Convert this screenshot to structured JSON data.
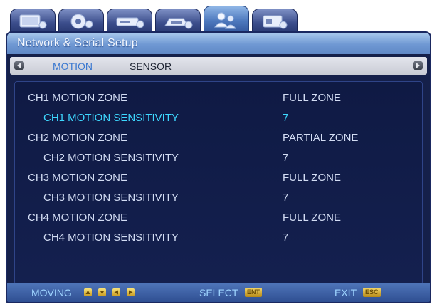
{
  "tabs": [
    {
      "name": "display",
      "icon": "display-setup-icon",
      "active": false
    },
    {
      "name": "record",
      "icon": "record-setup-icon",
      "active": false
    },
    {
      "name": "storage",
      "icon": "storage-setup-icon",
      "active": false
    },
    {
      "name": "schedule",
      "icon": "schedule-setup-icon",
      "active": false
    },
    {
      "name": "network",
      "icon": "network-setup-icon",
      "active": true
    },
    {
      "name": "system",
      "icon": "system-setup-icon",
      "active": false
    }
  ],
  "title": "Network & Serial Setup",
  "sub_tabs": {
    "motion": "MOTION",
    "sensor": "SENSOR",
    "active": "motion"
  },
  "settings": [
    {
      "label": "CH1 MOTION ZONE",
      "value": "FULL ZONE",
      "kind": "zone",
      "selected": false
    },
    {
      "label": "CH1 MOTION SENSITIVITY",
      "value": "7",
      "kind": "sens",
      "selected": true
    },
    {
      "label": "CH2 MOTION ZONE",
      "value": "PARTIAL ZONE",
      "kind": "zone",
      "selected": false
    },
    {
      "label": "CH2 MOTION SENSITIVITY",
      "value": "7",
      "kind": "sens",
      "selected": false
    },
    {
      "label": "CH3 MOTION ZONE",
      "value": "FULL ZONE",
      "kind": "zone",
      "selected": false
    },
    {
      "label": "CH3 MOTION SENSITIVITY",
      "value": "7",
      "kind": "sens",
      "selected": false
    },
    {
      "label": "CH4 MOTION ZONE",
      "value": "FULL ZONE",
      "kind": "zone",
      "selected": false
    },
    {
      "label": "CH4 MOTION SENSITIVITY",
      "value": "7",
      "kind": "sens",
      "selected": false
    }
  ],
  "status_bar": {
    "moving_label": "MOVING",
    "select_label": "SELECT",
    "select_key": "ENT",
    "exit_label": "EXIT",
    "exit_key": "ESC"
  },
  "colors": {
    "panel_background": "#15204a",
    "title_bar": "#6f98d3",
    "selected_text": "#3ed8ff",
    "normal_text": "#d3ddf4",
    "active_sub_tab": "#3a78d0"
  }
}
